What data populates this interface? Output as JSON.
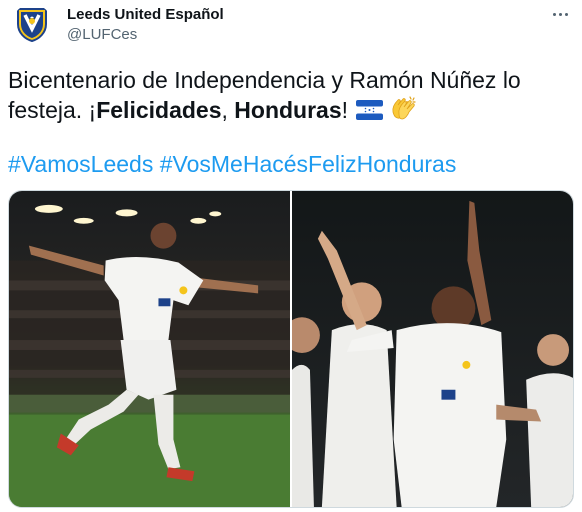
{
  "author": {
    "name": "Leeds United Español",
    "handle": "@LUFCes",
    "avatar_icon": "leeds-crest-icon"
  },
  "more_icon": "more-horizontal-icon",
  "tweet": {
    "text_part1": "Bicentenario de Independencia y Ramón Núñez lo festeja. ¡",
    "bold1": "Felicidades",
    "text_part2": ", ",
    "bold2": "Honduras",
    "text_part3": "!",
    "emoji_flag": "honduras-flag-icon",
    "emoji_clap": "clapping-hands-icon"
  },
  "hashtags": [
    "#VamosLeeds",
    "#VosMeHacésFelizHonduras"
  ],
  "media": {
    "photos": [
      {
        "name": "photo-player-celebrating-running"
      },
      {
        "name": "photo-player-pointing-up"
      }
    ]
  },
  "colors": {
    "link": "#1d9bf0",
    "text": "#0f1419",
    "secondary": "#536471",
    "leeds_yellow": "#f4c41b",
    "leeds_blue": "#1d428a"
  }
}
